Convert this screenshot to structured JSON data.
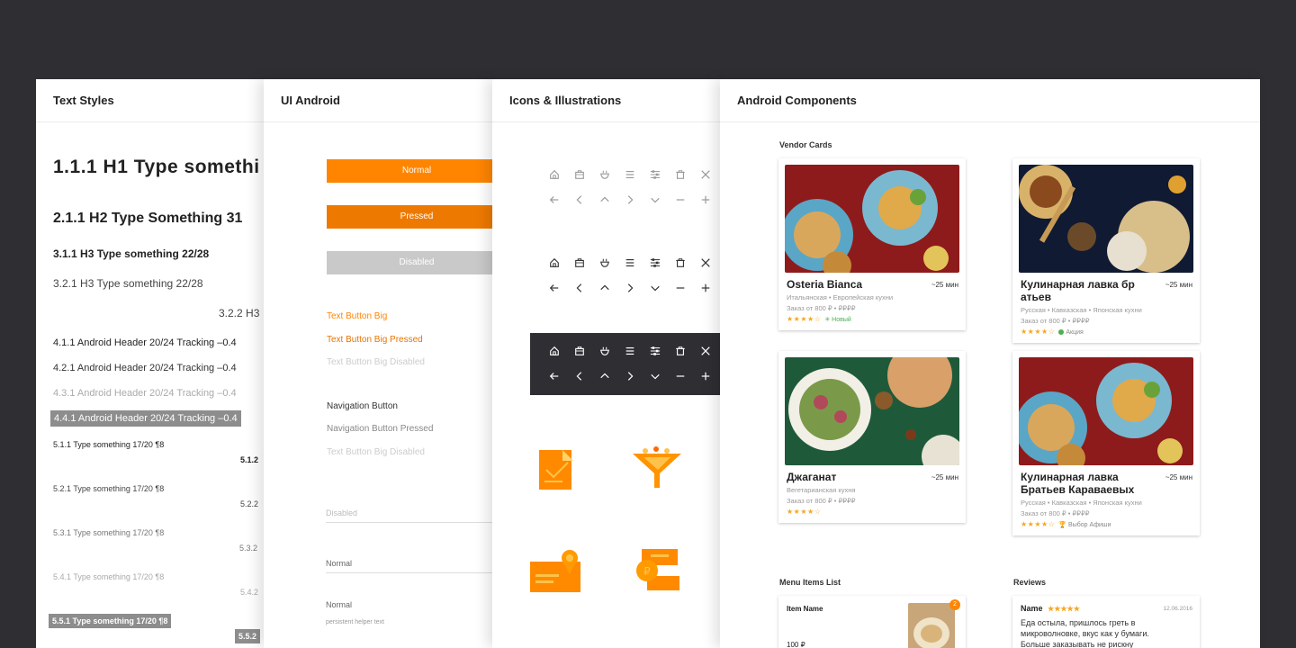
{
  "panels": {
    "text_styles": {
      "title": "Text Styles",
      "h1": "1.1.1  H1  Type somethi",
      "h2": "2.1.1  H2  Type Something  31",
      "h3_bold": "3.1.1  H3  Type something  22/28",
      "h3_regular": "3.2.1  H3  Type something  22/28",
      "h3_right": "3.2.2  H3",
      "hdr_1": "4.1.1  Android Header  20/24   Tracking –0.4",
      "hdr_2": "4.2.1  Android Header  20/24   Tracking –0.4",
      "hdr_3": "4.3.1  Android Header  20/24   Tracking –0.4",
      "hdr_4": "4.4.1  Android Header  20/24   Tracking –0.4",
      "b1": "5.1.1  Type something  17/20  ¶8",
      "b1r": "5.1.2",
      "b2": "5.2.1  Type something  17/20  ¶8",
      "b2r": "5.2.2",
      "b3": "5.3.1  Type something  17/20  ¶8",
      "b3r": "5.3.2",
      "b4": "5.4.1  Type something  17/20  ¶8",
      "b4r": "5.4.2",
      "b5": "5.5.1  Type something  17/20  ¶8",
      "b5r": "5.5.2"
    },
    "ui_android": {
      "title": "UI Android",
      "btn_normal": "Normal",
      "btn_pressed": "Pressed",
      "btn_disabled": "Disabled",
      "text_btn_big": "Text Button Big",
      "text_btn_big_pressed": "Text Button Big Pressed",
      "text_btn_big_disabled": "Text Button Big Disabled",
      "nav_btn": "Navigation Button",
      "nav_btn_pressed": "Navigation Button Pressed",
      "nav_btn_disabled": "Text Button Big Disabled",
      "field_disabled": "Disabled",
      "field_normal": "Normal",
      "field_normal_2": "Normal",
      "helper_text": "persistent helper text",
      "colors": {
        "orange": "#ff8500",
        "orange_pressed": "#ef7a00",
        "disabled": "#c8c8c8"
      }
    },
    "icons": {
      "title": "Icons & Illustrations",
      "row_top": [
        "home-icon",
        "bag-icon",
        "bowl-icon",
        "menu-icon",
        "filter-icon",
        "trash-icon",
        "close-icon"
      ],
      "row_bottom": [
        "arrow-left-icon",
        "chevron-left-icon",
        "chevron-up-icon",
        "chevron-right-icon",
        "chevron-down-icon",
        "minus-icon",
        "plus-icon"
      ],
      "illustrations": [
        "order-document-illustration",
        "funnel-illustration",
        "map-card-illustration",
        "payment-card-illustration"
      ]
    },
    "components": {
      "title": "Android Components",
      "vendor_cards_label": "Vendor Cards",
      "cards": [
        {
          "name": "Osteria Bianca",
          "time": "~25 мин",
          "cuisine": "Итальянская • Европейская кухни",
          "order": "Заказ от 800 ₽ • ₽₽₽₽",
          "stars": "★★★★☆",
          "badge": "✳ Новый"
        },
        {
          "name": "Кулинарная лавка бр атьев",
          "time": "~25 мин",
          "cuisine": "Русская • Кавказская • Японская кухни",
          "order": "Заказ от 800 ₽ • ₽₽₽₽",
          "stars": "★★★★☆",
          "badge": "Акция"
        },
        {
          "name": "Джаганат",
          "time": "~25 мин",
          "cuisine": "Вегетарианская кухня",
          "order": "Заказ от 800 ₽ • ₽₽₽₽",
          "stars": "★★★★☆",
          "badge": ""
        },
        {
          "name": "Кулинарная лавка Братьев Караваевых",
          "time": "~25 мин",
          "cuisine": "Русская • Кавказская • Японская кухни",
          "order": "Заказ от 800 ₽ • ₽₽₽₽",
          "stars": "★★★★☆",
          "badge": "🏆 Выбор Афиши"
        }
      ],
      "menu_items_label": "Menu Items List",
      "menu_item": {
        "name": "Item Name",
        "price": "100 ₽",
        "count": "2"
      },
      "reviews_label": "Reviews",
      "review": {
        "name": "Name",
        "stars": "★★★★★",
        "date": "12.06.2016",
        "text_1": "Еда остыла, пришлось греть в",
        "text_2": "микроволновке, вкус как у бумаги.",
        "text_3": "Больше заказывать не рискну"
      }
    }
  }
}
